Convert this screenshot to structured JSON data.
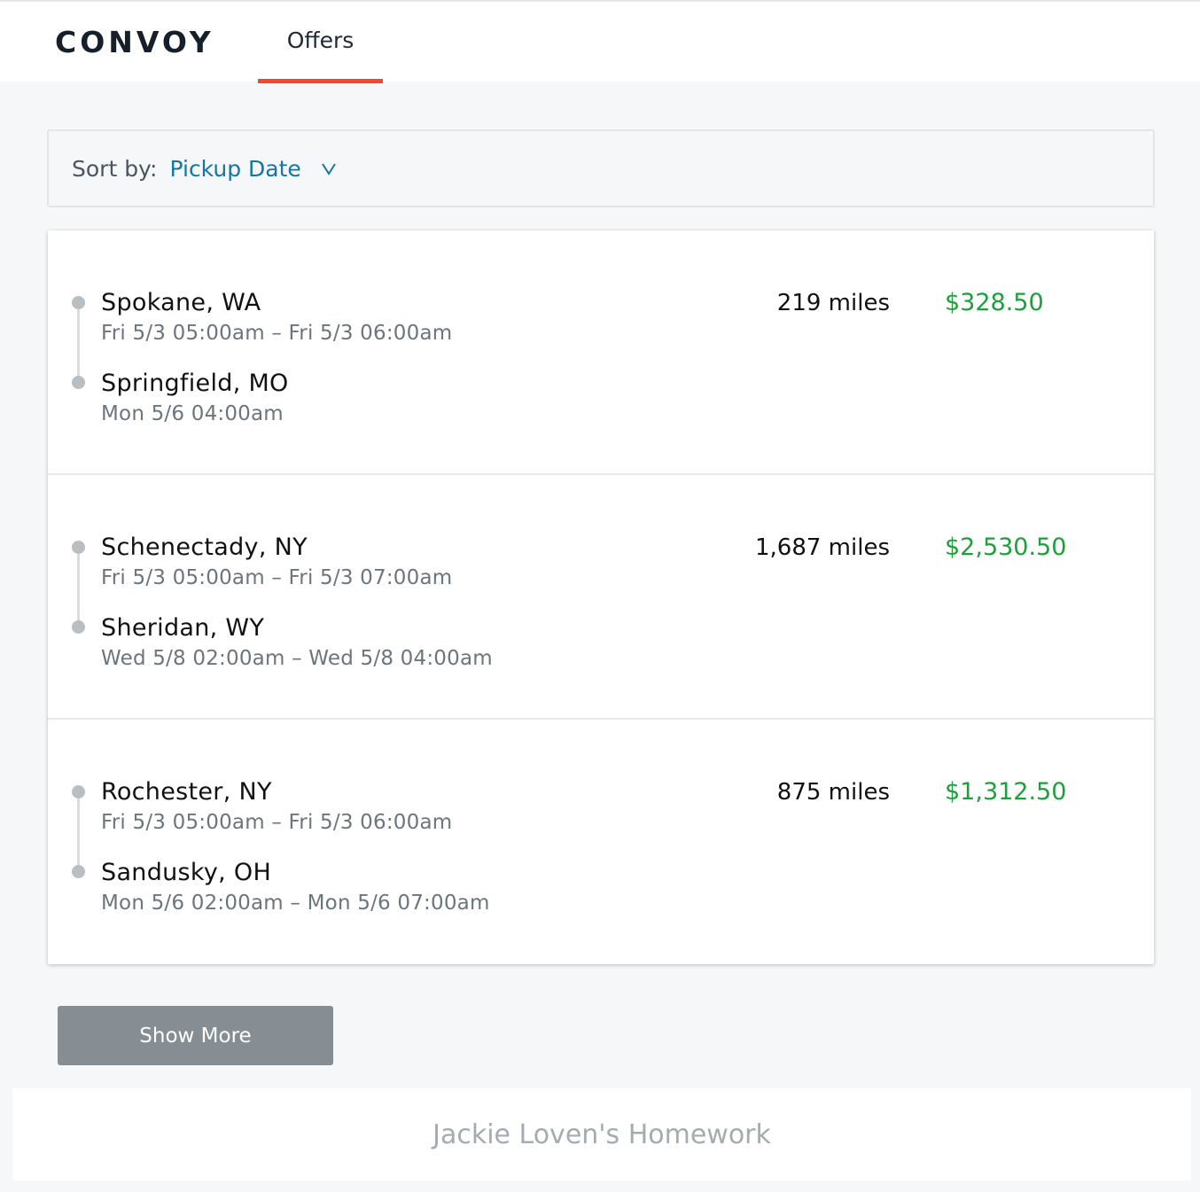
{
  "header": {
    "logo": "CONVOY",
    "tabs": [
      {
        "label": "Offers",
        "active": true
      }
    ],
    "accent_color": "#f24a28"
  },
  "sort": {
    "label": "Sort by:",
    "selected": "Pickup Date",
    "icon": "chevron-down-icon"
  },
  "offers": [
    {
      "origin": {
        "city": "Spokane, WA",
        "time": "Fri 5/3 05:00am – Fri 5/3 06:00am"
      },
      "destination": {
        "city": "Springfield, MO",
        "time": "Mon 5/6 04:00am"
      },
      "miles": "219 miles",
      "price": "$328.50"
    },
    {
      "origin": {
        "city": "Schenectady, NY",
        "time": "Fri 5/3 05:00am – Fri 5/3 07:00am"
      },
      "destination": {
        "city": "Sheridan, WY",
        "time": "Wed 5/8 02:00am – Wed 5/8 04:00am"
      },
      "miles": "1,687 miles",
      "price": "$2,530.50"
    },
    {
      "origin": {
        "city": "Rochester, NY",
        "time": "Fri 5/3 05:00am – Fri 5/3 06:00am"
      },
      "destination": {
        "city": "Sandusky, OH",
        "time": "Mon 5/6 02:00am – Mon 5/6 07:00am"
      },
      "miles": "875 miles",
      "price": "$1,312.50"
    }
  ],
  "price_color": "#1f9e3c",
  "show_more_label": "Show More",
  "footer": {
    "text": "Jackie Loven's Homework"
  }
}
